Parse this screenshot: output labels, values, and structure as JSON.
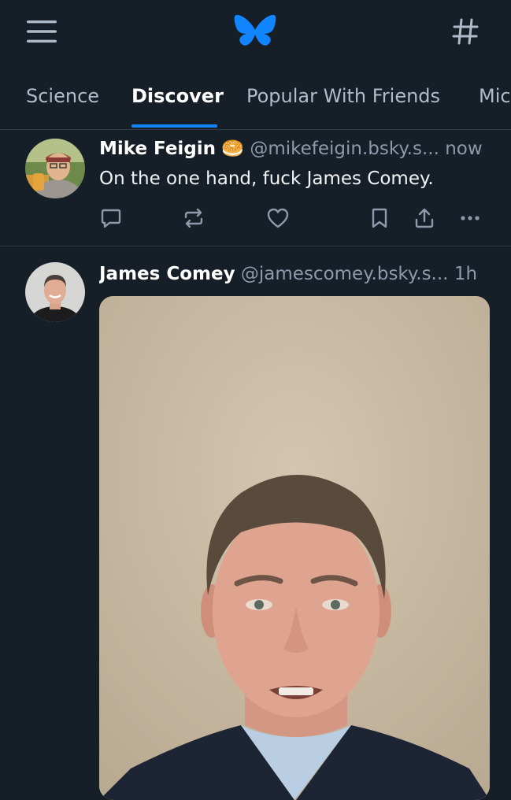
{
  "header": {
    "menu_icon": "hamburger-menu-icon",
    "logo_icon": "butterfly-logo-icon",
    "feeds_icon": "hashtag-icon"
  },
  "tabs": [
    {
      "label": "Science",
      "active": false
    },
    {
      "label": "Discover",
      "active": true
    },
    {
      "label": "Popular With Friends",
      "active": false
    },
    {
      "label": "Mic",
      "active": false
    }
  ],
  "posts": [
    {
      "author_name": "Mike Feigin",
      "emoji": "🥯",
      "handle": "@mikefeigin.bsky.s...",
      "time": "now",
      "text": "On the one hand, fuck James Comey.",
      "actions": [
        "reply-icon",
        "repost-icon",
        "like-icon",
        "bookmark-icon",
        "share-icon",
        "more-icon"
      ]
    },
    {
      "author_name": "James Comey",
      "handle": "@jamescomey.bsky.s...",
      "time": "1h",
      "media": "video"
    }
  ],
  "colors": {
    "background": "#161e27",
    "accent": "#1185fe",
    "muted_text": "#8c9aab",
    "divider": "#2e3945"
  }
}
